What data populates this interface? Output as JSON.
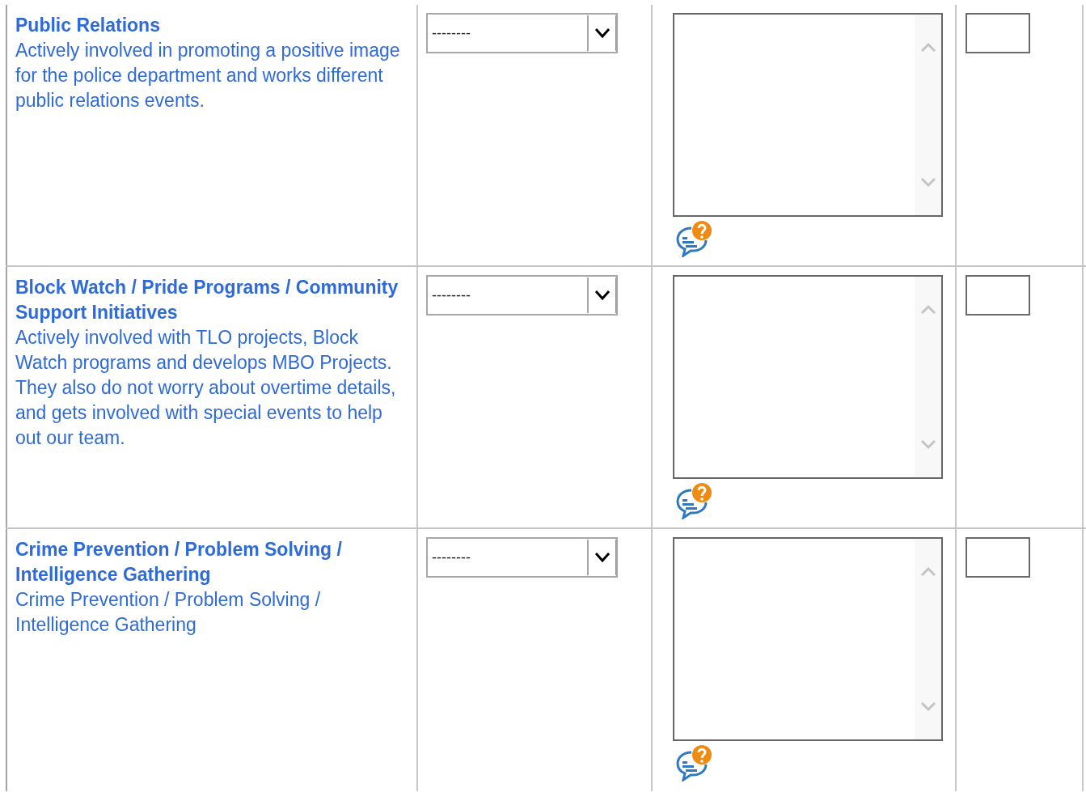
{
  "rows": [
    {
      "title": "Public Relations",
      "description": "Actively involved in promoting a positive image for the police department and works different public relations events.",
      "rating": "--------"
    },
    {
      "title": "Block Watch / Pride Programs / Community Support Initiatives",
      "description": "Actively involved with TLO projects, Block Watch programs and develops MBO Projects. They also do not worry about overtime details, and gets involved with special events to help out our team.",
      "rating": "--------"
    },
    {
      "title": "Crime Prevention / Problem Solving / Intelligence Gathering",
      "description": "Crime Prevention / Problem Solving / Intelligence Gathering",
      "rating": "--------"
    }
  ]
}
